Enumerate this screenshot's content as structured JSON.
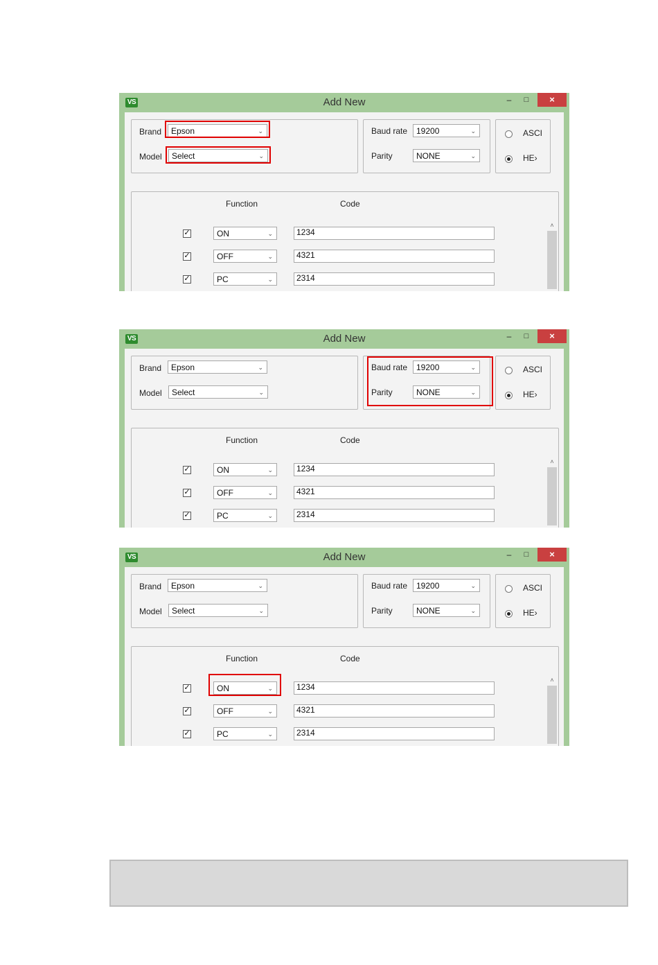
{
  "dialog": {
    "logo": "VS",
    "title": "Add New",
    "window_buttons": {
      "minimize": "–",
      "maximize": "□",
      "close": "×"
    },
    "brand_label": "Brand",
    "brand_value": "Epson",
    "model_label": "Model",
    "model_value": "Select",
    "baud_label": "Baud rate",
    "baud_value": "19200",
    "parity_label": "Parity",
    "parity_value": "NONE",
    "ascii_label": "ASCI",
    "hex_label": "HE›",
    "format_selected": "HEX",
    "function_header": "Function",
    "code_header": "Code",
    "rows": [
      {
        "checked": true,
        "function": "ON",
        "code": "1234"
      },
      {
        "checked": true,
        "function": "OFF",
        "code": "4321"
      },
      {
        "checked": true,
        "function": "PC",
        "code": "2314"
      }
    ],
    "checkmark": "✓",
    "chevron": "⌄",
    "scroll_up": "˄"
  },
  "screenshots": [
    {
      "id": "shot-1",
      "highlight": "brand-model"
    },
    {
      "id": "shot-2",
      "highlight": "baud-parity"
    },
    {
      "id": "shot-3",
      "highlight": "function-on"
    }
  ],
  "highlight_color": "#e00000",
  "titlebar_color": "#a5cb9a",
  "close_color": "#c94040",
  "note_box": {
    "text": ""
  }
}
